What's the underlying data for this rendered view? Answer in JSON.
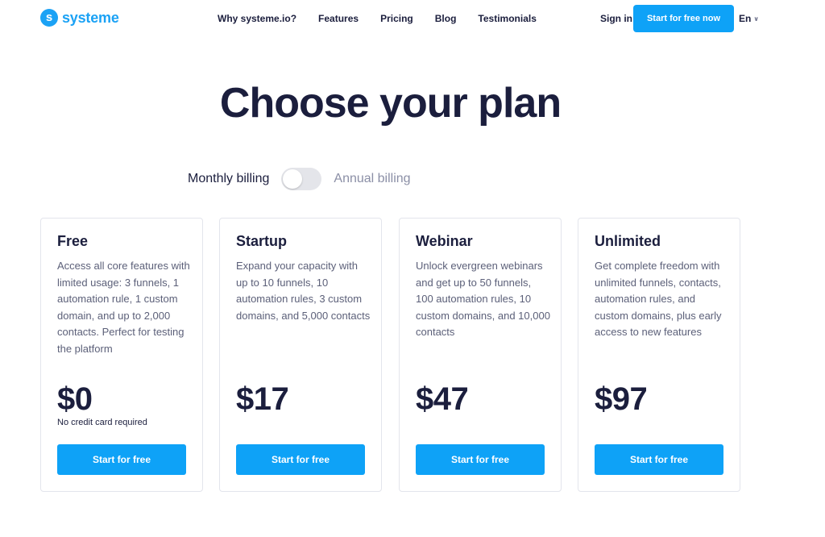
{
  "brand": {
    "name": "systeme",
    "icon_letter": "s",
    "color": "#1ba2f5"
  },
  "nav": {
    "links": [
      "Why systeme.io?",
      "Features",
      "Pricing",
      "Blog",
      "Testimonials"
    ],
    "signin": "Sign in",
    "cta": "Start for free now",
    "language": "En",
    "language_icon": "chevron-down-icon"
  },
  "headline": "Choose your plan",
  "billing": {
    "monthly_label": "Monthly billing",
    "annual_label": "Annual billing",
    "annual_enabled": false
  },
  "plans": [
    {
      "name": "Free",
      "description": "Access all core features with limited usage: 3 funnels, 1 automation rule, 1 custom domain, and up to 2,000 contacts. Perfect for testing the platform",
      "price": "$0",
      "note": "No credit card required",
      "button": "Start for free"
    },
    {
      "name": "Startup",
      "description": "Expand your capacity with up to 10 funnels, 10 automation rules, 3 custom domains, and 5,000 contacts",
      "price": "$17",
      "note": "",
      "button": "Start for free"
    },
    {
      "name": "Webinar",
      "description": "Unlock evergreen webinars and get up to 50 funnels, 100 automation rules, 10 custom domains, and 10,000 contacts",
      "price": "$47",
      "note": "",
      "button": "Start for free"
    },
    {
      "name": "Unlimited",
      "description": "Get complete freedom with unlimited funnels, contacts, automation rules, and custom domains, plus early access to new features",
      "price": "$97",
      "note": "",
      "button": "Start for free"
    }
  ],
  "colors": {
    "accent": "#0ea2f7",
    "text": "#1b1e3d",
    "muted": "#5c6079"
  }
}
